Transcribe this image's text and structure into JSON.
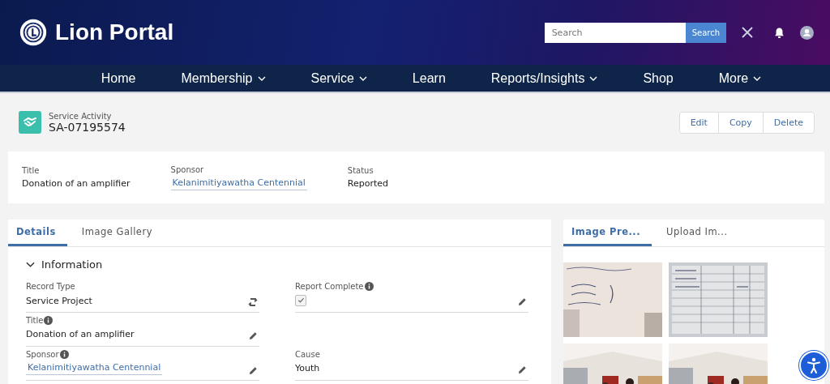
{
  "header": {
    "brand": "Lion Portal",
    "search": {
      "placeholder": "Search",
      "button": "Search"
    }
  },
  "nav": [
    {
      "label": "Home",
      "dropdown": false
    },
    {
      "label": "Membership",
      "dropdown": true
    },
    {
      "label": "Service",
      "dropdown": true
    },
    {
      "label": "Learn",
      "dropdown": false
    },
    {
      "label": "Reports/Insights",
      "dropdown": true
    },
    {
      "label": "Shop",
      "dropdown": false
    },
    {
      "label": "More",
      "dropdown": true
    }
  ],
  "record": {
    "type": "Service Activity",
    "name": "SA-07195574",
    "actions": [
      "Edit",
      "Copy",
      "Delete"
    ]
  },
  "highlights": [
    {
      "label": "Title",
      "value": "Donation of an amplifier",
      "link": false
    },
    {
      "label": "Sponsor",
      "value": "Kelanimitiyawatha Centennial",
      "link": true
    },
    {
      "label": "Status",
      "value": "Reported",
      "link": false
    }
  ],
  "detail_tabs": [
    {
      "label": "Details",
      "selected": true
    },
    {
      "label": "Image Gallery",
      "selected": false
    }
  ],
  "section": {
    "title": "Information",
    "expanded": true
  },
  "rows": [
    {
      "left": {
        "label": "Record Type",
        "info": false,
        "kind": "text",
        "value": "Service Project",
        "editable": false,
        "changeable": true
      },
      "right": {
        "label": "Report Complete",
        "info": true,
        "kind": "checkbox",
        "checked": true,
        "editable": true,
        "changeable": false
      }
    },
    {
      "left": {
        "label": "Title",
        "info": true,
        "kind": "text",
        "value": "Donation of an amplifier",
        "editable": true,
        "changeable": false
      }
    },
    {
      "left": {
        "label": "Sponsor",
        "info": true,
        "kind": "link",
        "value": "Kelanimitiyawatha Centennial",
        "editable": true,
        "changeable": false
      },
      "right": {
        "label": "Cause",
        "info": false,
        "kind": "text",
        "value": "Youth",
        "editable": true,
        "changeable": false
      }
    }
  ],
  "image_tabs": [
    {
      "label": "Image Pre...",
      "selected": true
    },
    {
      "label": "Upload Im...",
      "selected": false
    }
  ]
}
